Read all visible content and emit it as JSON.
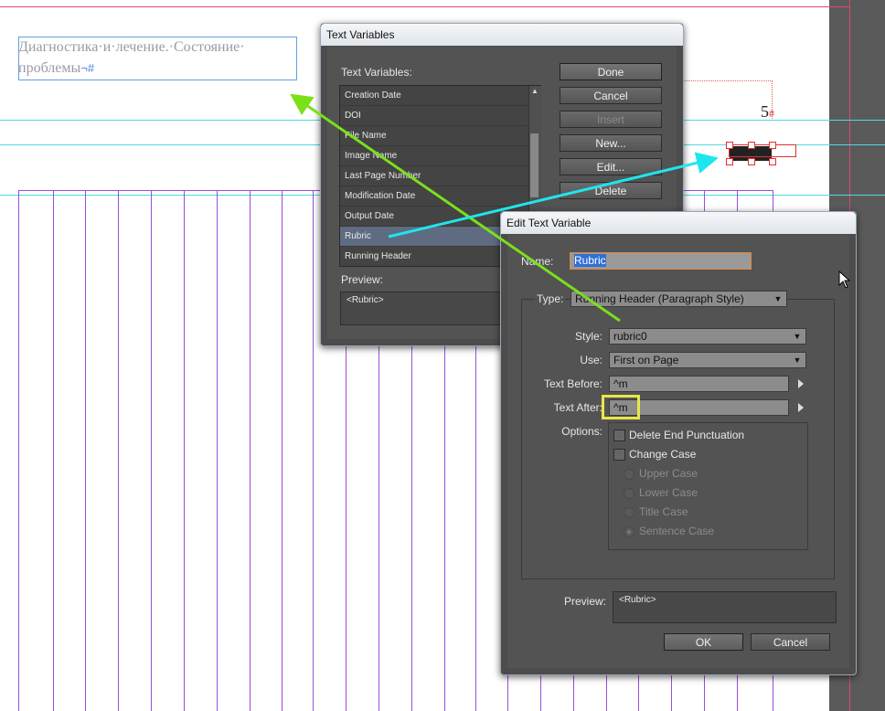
{
  "canvas": {
    "header_text": "Диагностика·и·лечение.·Состояние· проблемы",
    "header_marks": "¬#",
    "folio_number": "5",
    "folio_mark": "#"
  },
  "text_variables_dialog": {
    "title": "Text Variables",
    "list_label": "Text Variables:",
    "items": [
      "Creation Date",
      "DOI",
      "File Name",
      "Image Name",
      "Last Page Number",
      "Modification Date",
      "Output Date",
      "Rubric",
      "Running Header"
    ],
    "selected": "Rubric",
    "buttons": {
      "done": "Done",
      "cancel": "Cancel",
      "insert": "Insert",
      "new": "New...",
      "edit": "Edit...",
      "delete": "Delete"
    },
    "preview_label": "Preview:",
    "preview_value": "<Rubric>"
  },
  "edit_dialog": {
    "title": "Edit Text Variable",
    "name_label": "Name:",
    "name_value": "Rubric",
    "type_label": "Type:",
    "type_value": "Running Header (Paragraph Style)",
    "style_label": "Style:",
    "style_value": "rubric0",
    "use_label": "Use:",
    "use_value": "First on Page",
    "text_before_label": "Text Before:",
    "text_before_value": "^m",
    "text_after_label": "Text After:",
    "text_after_value": "^m",
    "options_label": "Options:",
    "delete_end_punctuation": "Delete End Punctuation",
    "change_case": "Change Case",
    "case_options": [
      "Upper Case",
      "Lower Case",
      "Title Case",
      "Sentence Case"
    ],
    "preview_label": "Preview:",
    "preview_value": "<Rubric>",
    "ok": "OK",
    "cancel": "Cancel"
  },
  "colors": {
    "guide": "#4fd9e8",
    "column": "#9b4fd6",
    "annotation_green": "#7be01a",
    "annotation_cyan": "#1ee6ee",
    "highlight_yellow": "#e7e64a"
  }
}
